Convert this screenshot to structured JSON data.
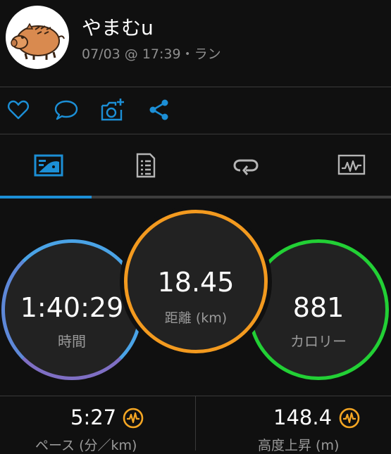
{
  "header": {
    "username": "やまむu",
    "meta": "07/03 @ 17:39・ラン"
  },
  "actions": [
    {
      "icon": "heart-icon"
    },
    {
      "icon": "comment-icon"
    },
    {
      "icon": "add-photo-icon"
    },
    {
      "icon": "share-icon"
    }
  ],
  "tabs": [
    {
      "icon": "stats-tab-icon",
      "active": true
    },
    {
      "icon": "details-tab-icon",
      "active": false
    },
    {
      "icon": "laps-tab-icon",
      "active": false
    },
    {
      "icon": "chart-tab-icon",
      "active": false
    }
  ],
  "stats": {
    "time": {
      "value": "1:40:29",
      "label": "時間"
    },
    "distance": {
      "value": "18.45",
      "label": "距離",
      "unit": "(km)"
    },
    "calories": {
      "value": "881",
      "label": "カロリー"
    }
  },
  "metrics": {
    "pace": {
      "value": "5:27",
      "label": "ペース (分／km)"
    },
    "elevation": {
      "value": "148.4",
      "label": "高度上昇 (m)"
    }
  },
  "colors": {
    "accent_blue": "#1c8fd6",
    "time_ring": "#4aa3e6",
    "distance_ring": "#f39a1f",
    "calories_ring": "#22d035",
    "badge": "#f5a623"
  }
}
